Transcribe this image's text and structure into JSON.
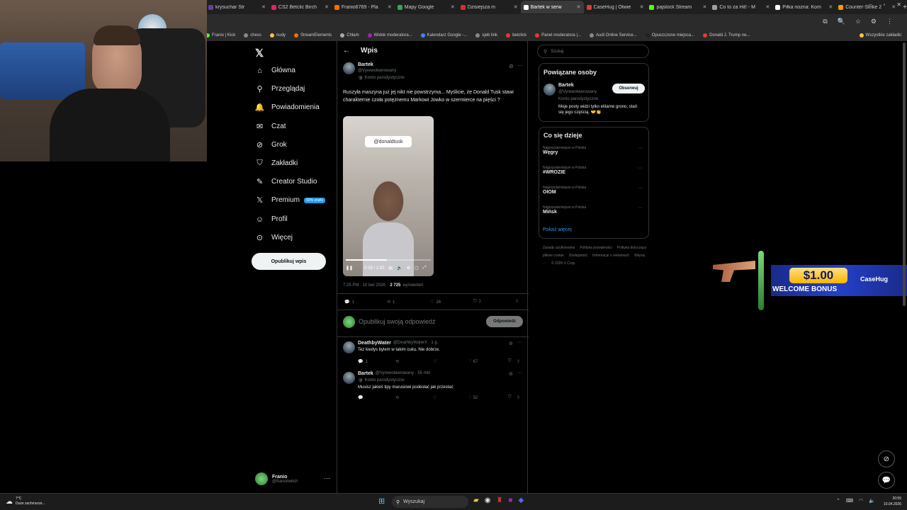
{
  "tabs": [
    {
      "label": "krysuchar Str",
      "color": "#6441a5"
    },
    {
      "label": "CS2 Betclic Birch",
      "color": "#e91e63"
    },
    {
      "label": "Franio6769 - Pla",
      "color": "#ff6d00"
    },
    {
      "label": "Mapy Google",
      "color": "#34a853"
    },
    {
      "label": "Dzisiejsza m",
      "color": "#d32f2f"
    },
    {
      "label": "Bartek w serw",
      "color": "#ffffff",
      "active": true
    },
    {
      "label": "CaseHug | Otwie",
      "color": "#e53935"
    },
    {
      "label": "pajslock Stream",
      "color": "#53fc18"
    },
    {
      "label": "Co to za Hit! - M",
      "color": "#9e9e9e"
    },
    {
      "label": "Piłka nożna: Kom",
      "color": "#ffffff"
    },
    {
      "label": "Counter-Strike 2",
      "color": "#ff9800"
    }
  ],
  "bookmarks": [
    "Franio | Kick",
    "chess",
    "nudy",
    "StreamElements",
    "Chłam",
    "Widok moderatora...",
    "Kalendarz Google -...",
    "sjeb link",
    "betclick",
    "Panel moderatora |...",
    "Audi Online Service...",
    "Opuszczone miejsca...",
    "Donald J. Trump ne...",
    "Wszystkie zakładki"
  ],
  "nav": {
    "items": [
      "Główna",
      "Przeglądaj",
      "Powiadomienia",
      "Czat",
      "Grok",
      "Zakładki",
      "Creator Studio",
      "Premium",
      "Profil",
      "Więcej"
    ],
    "premium_badge": "50% zniżki",
    "post_button": "Opublikuj wpis",
    "account": {
      "name": "Franio",
      "handle": "@franiotwitch"
    }
  },
  "header": {
    "title": "Wpis"
  },
  "tweet": {
    "name": "Bartek",
    "handle": "@Vyrewolwerowany",
    "parody": "Konto parodystyczne",
    "text": "Ruszyła maszyna już jej nikt nie powstrzyma... Myślicie, że Donald Tusk stawi charakternie czoła potężnemu Markowi Jowko w szermierce na pięści ?",
    "video_tag": "@donaldtusk",
    "video_time": "0:29 / 1:00",
    "video_progress": 0.48,
    "meta_time": "7:25 PM · 10 kwi 2026 ·",
    "views": "2 725",
    "views_label": "wyświetleń",
    "stats": {
      "replies": "1",
      "retweets": "1",
      "likes": "16",
      "bookmarks": "7"
    }
  },
  "reply_box": {
    "placeholder": "Opublikuj swoją odpowiedź",
    "button": "Odpowiedz"
  },
  "replies": [
    {
      "name": "DeathbyWater",
      "handle": "@DeathbyWaterX · 1 g.",
      "text": "Tez kiedys bylem w takim cuku.  Nie dobrze.",
      "replies": "1",
      "views": "67"
    },
    {
      "name": "Bartek",
      "handle": "@Vyrewolwerowany · 55 min",
      "parody": "Konto parodystyczne",
      "text": "Musisz jakieś tipy marusiowi podesłać jak przestać",
      "views": "32"
    }
  ],
  "search": {
    "placeholder": "Szukaj"
  },
  "related": {
    "title": "Powiązane osoby",
    "name": "Bartek",
    "handle": "@Vyrewolwerowany",
    "parody": "Konto parodystyczne",
    "bio": "Moje posty widzi tylko elitarne grono, stań się jego częścią. 🤝👏",
    "follow": "Obserwuj"
  },
  "trends": {
    "title": "Co się dzieje",
    "items": [
      {
        "cat": "Najpopularniejsze w Polska",
        "name": "Węgry"
      },
      {
        "cat": "Najpopularniejsze w Polska",
        "name": "#WROZIE"
      },
      {
        "cat": "Najpopularniejsze w Polska",
        "name": "OIOM"
      },
      {
        "cat": "Najpopularniejsze w Polska",
        "name": "Mińsk"
      }
    ],
    "more": "Pokaż więcej"
  },
  "footer": [
    "Zasady użytkowania",
    "Polityka prywatności",
    "Polityka dotycząca plików cookie",
    "Dostępność",
    "Informacje o reklamach",
    "Więcej ···",
    "© 2026 X Corp."
  ],
  "promo": {
    "price": "$1.00",
    "text": "WELCOME BONUS",
    "brand": "CaseHug"
  },
  "taskbar": {
    "weather_temp": "7°C",
    "weather_desc": "Duże zachmurze...",
    "search": "Wyszukaj",
    "time": "20:55",
    "date": "10.04.2026"
  }
}
